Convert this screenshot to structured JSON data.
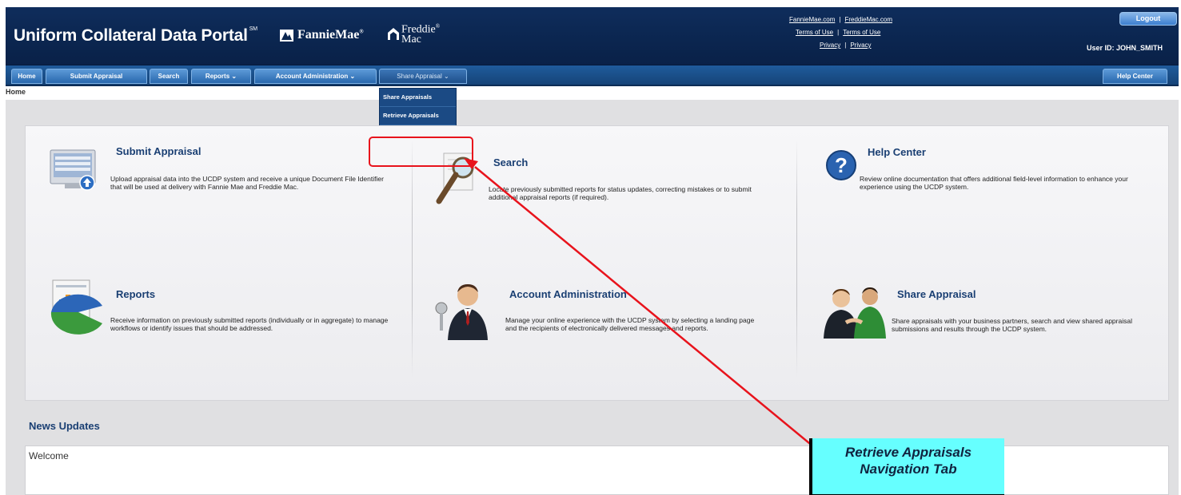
{
  "header": {
    "title": "Uniform Collateral Data Portal",
    "title_mark": "SM",
    "fanniemae": "FannieMae",
    "fanniemae_mark": "®",
    "freddiemac_line1": "Freddie",
    "freddiemac_mark": "®",
    "freddiemac_line2": "Mac",
    "links": {
      "fanniemae_com": "FannieMae.com",
      "freddiemac_com": "FreddieMac.com",
      "terms1": "Terms of Use",
      "terms2": "Terms of Use",
      "privacy1": "Privacy",
      "privacy2": "Privacy",
      "separator": "|"
    },
    "logout": "Logout",
    "user_id": "User ID: JOHN_SMITH"
  },
  "nav": {
    "home": "Home",
    "submit_appraisal": "Submit Appraisal",
    "search": "Search",
    "reports": "Reports ⌄",
    "account_admin": "Account Administration ⌄",
    "share_appraisal": "Share Appraisal ⌄",
    "help_center": "Help Center",
    "dropdown": [
      "Share Appraisals",
      "Retrieve Appraisals"
    ]
  },
  "breadcrumb": "Home",
  "cards": {
    "submit": {
      "title": "Submit Appraisal",
      "desc": "Upload appraisal data into the UCDP system and receive a unique Document File Identifier that will be used at delivery with Fannie Mae and Freddie Mac."
    },
    "search": {
      "title": "Search",
      "desc": "Locate previously submitted reports for status updates, correcting mistakes or to submit additional appraisal reports (if required)."
    },
    "help": {
      "title": "Help Center",
      "desc": "Review online documentation that offers additional field-level information to enhance your experience using the UCDP system."
    },
    "reports": {
      "title": "Reports",
      "desc": "Receive information on previously submitted reports (individually or in aggregate) to manage workflows or identify issues that should be addressed."
    },
    "account": {
      "title": "Account Administration",
      "desc": "Manage your online experience with the UCDP system by selecting a landing page and the recipients of electronically delivered messages and reports."
    },
    "share": {
      "title": "Share Appraisal",
      "desc": "Share appraisals with your business partners, search and view shared appraisal submissions and results through the UCDP system."
    }
  },
  "news": {
    "title": "News Updates",
    "text": "Welcome"
  },
  "annotation": {
    "line1": "Retrieve Appraisals",
    "line2": "Navigation Tab"
  },
  "colors": {
    "header_bg": "#0b2650",
    "nav_bg": "#1f5b9c",
    "card_title": "#1a3f73",
    "annotation_red": "#e8131c",
    "callout_bg": "#66ffff"
  }
}
